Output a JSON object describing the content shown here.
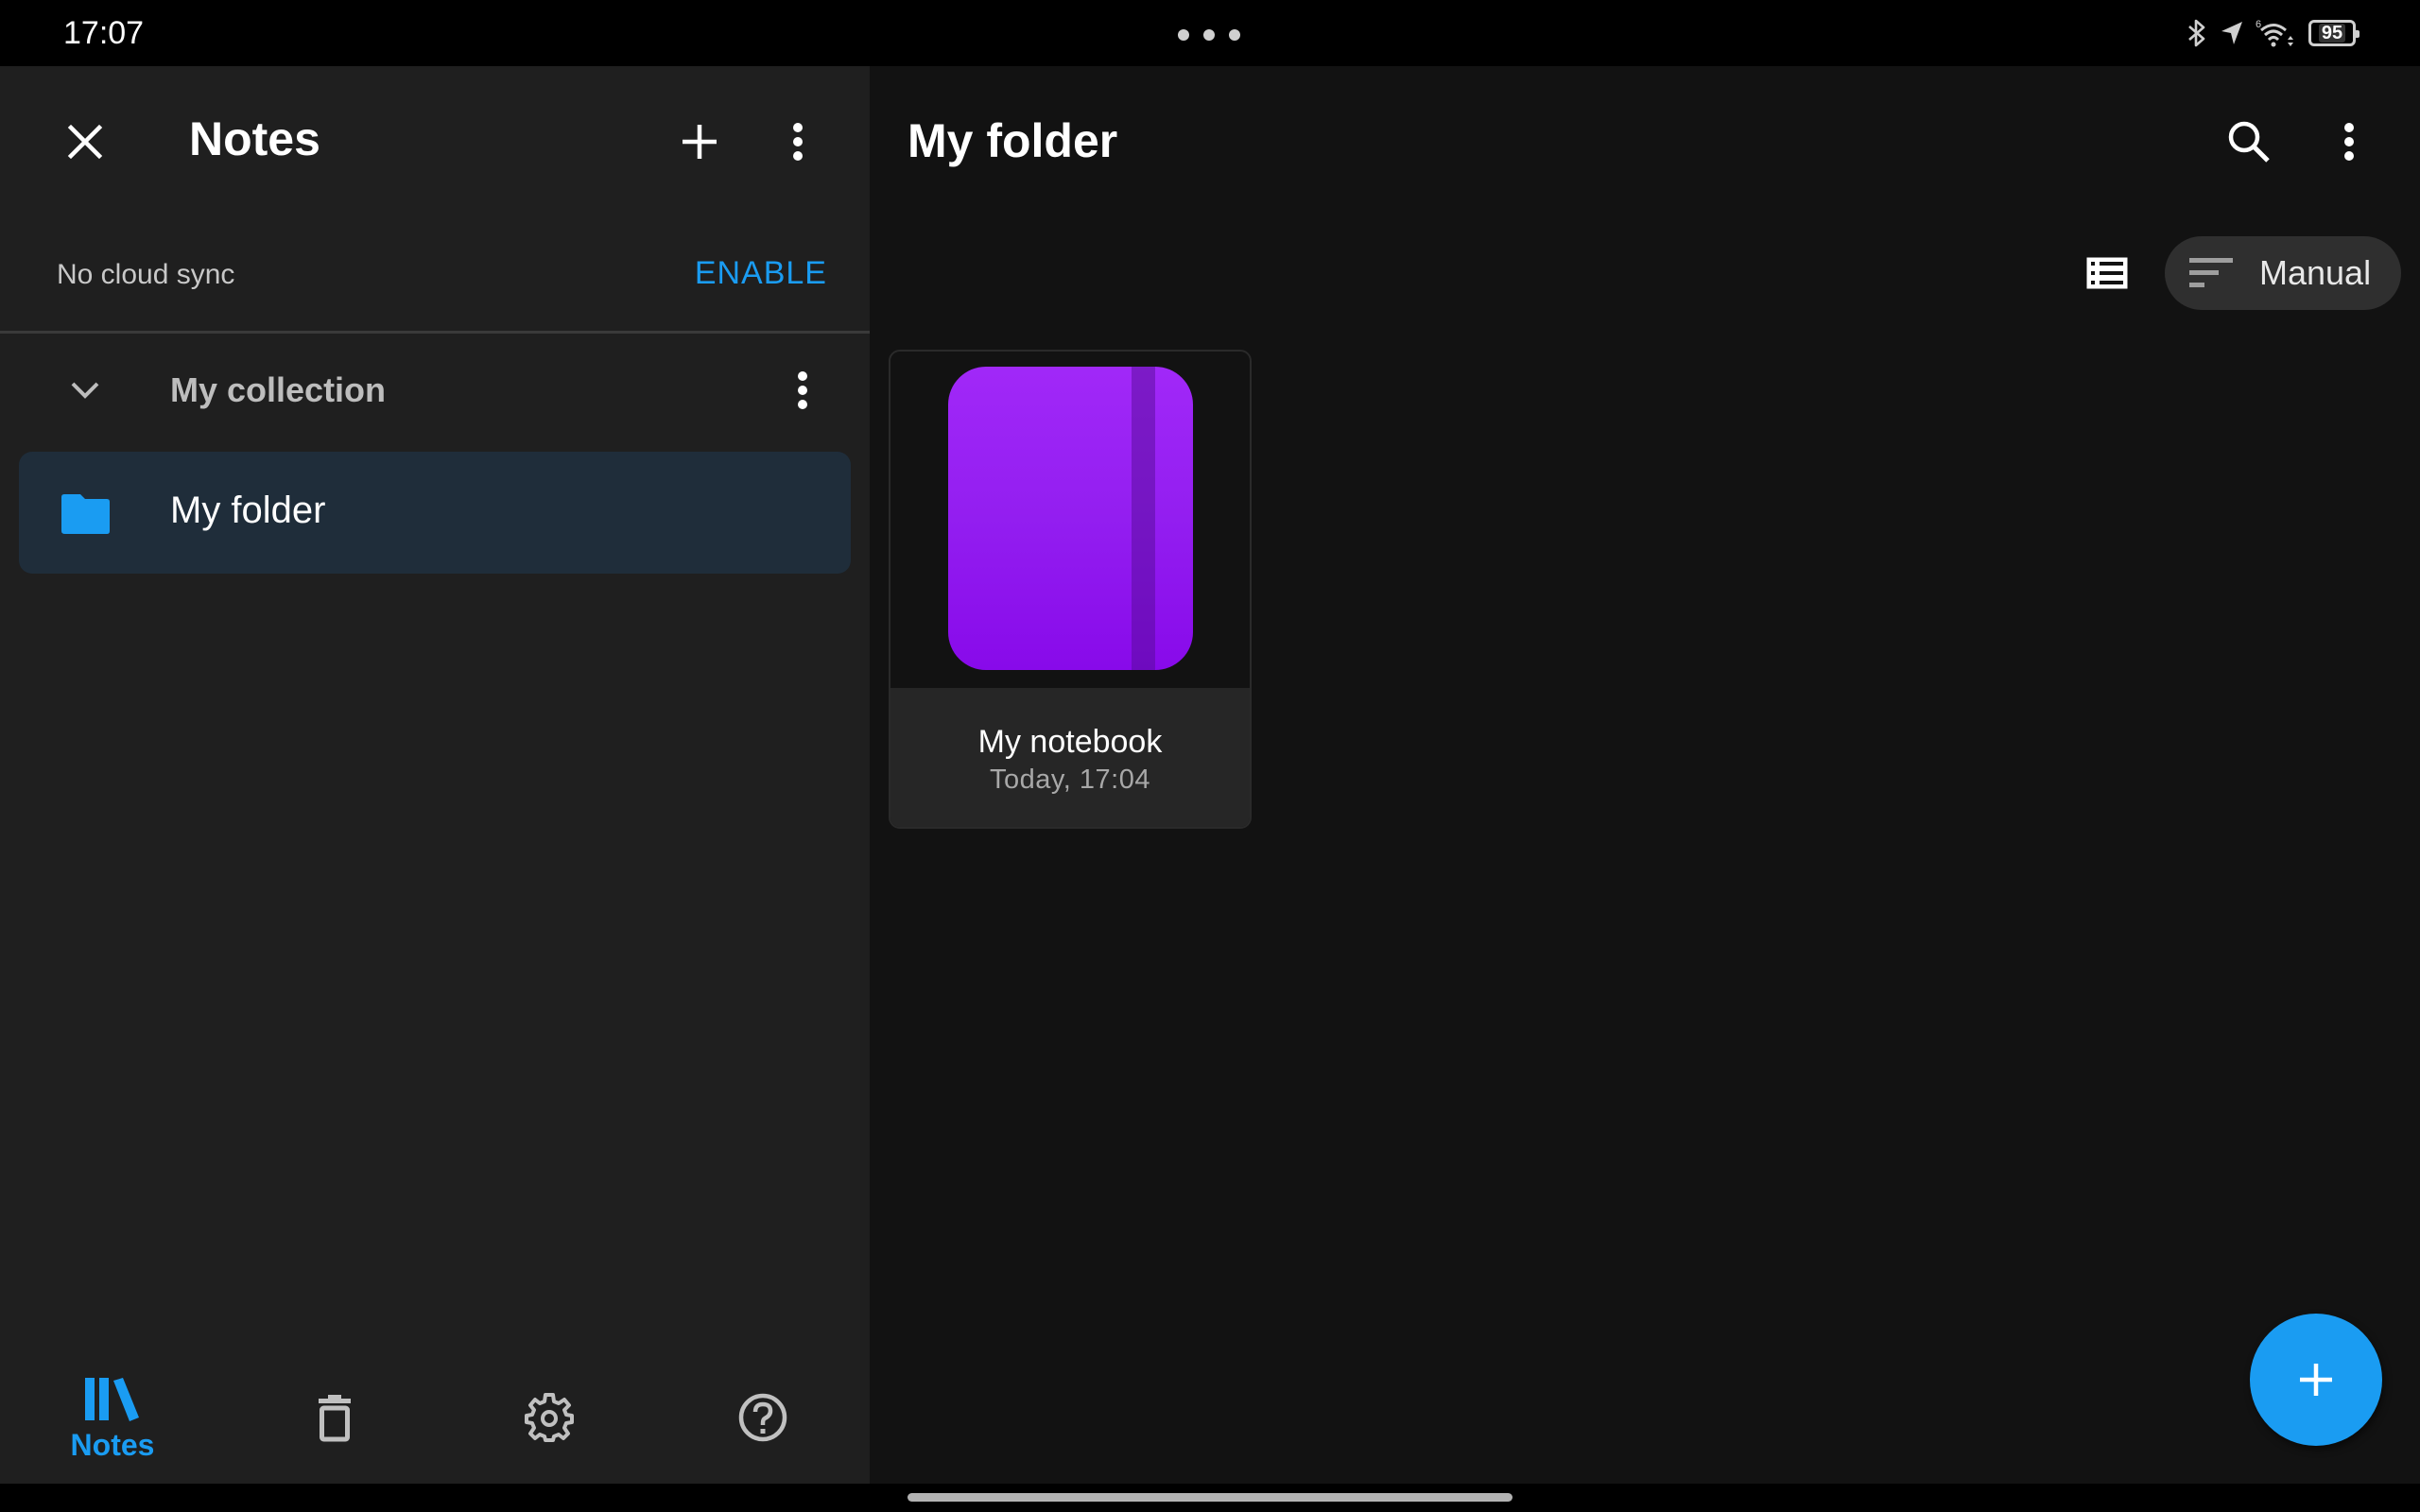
{
  "status_bar": {
    "time": "17:07",
    "icons": [
      "bluetooth-icon",
      "location-icon",
      "wifi-6-icon",
      "battery-icon"
    ],
    "wifi_label": "6",
    "battery_level": "95"
  },
  "left_panel": {
    "title": "Notes",
    "close_icon": "close-icon",
    "add_icon": "plus-icon",
    "more_icon": "more-vertical-icon",
    "sync": {
      "status_text": "No cloud sync",
      "enable_label": "ENABLE"
    },
    "collection": {
      "label": "My collection",
      "expanded": true,
      "folders": [
        {
          "label": "My folder",
          "icon": "folder-icon",
          "selected": true
        }
      ]
    },
    "bottom_nav": [
      {
        "label": "Notes",
        "icon": "library-icon",
        "active": true
      },
      {
        "label": "",
        "icon": "trash-icon",
        "active": false
      },
      {
        "label": "",
        "icon": "settings-icon",
        "active": false
      },
      {
        "label": "",
        "icon": "help-icon",
        "active": false
      }
    ]
  },
  "right_panel": {
    "title": "My folder",
    "search_icon": "search-icon",
    "more_icon": "more-vertical-icon",
    "view_toggle_icon": "list-view-icon",
    "sort": {
      "label": "Manual",
      "icon": "sort-icon"
    },
    "notebooks": [
      {
        "title": "My notebook",
        "date": "Today, 17:04",
        "cover_color": "#9a22f4"
      }
    ],
    "fab_icon": "plus-icon"
  },
  "colors": {
    "accent": "#1a9cf2",
    "left_bg": "#1f1f1f",
    "right_bg": "#121212",
    "selected_row": "#1f2d3a",
    "notebook_purple": "#9a22f4"
  }
}
